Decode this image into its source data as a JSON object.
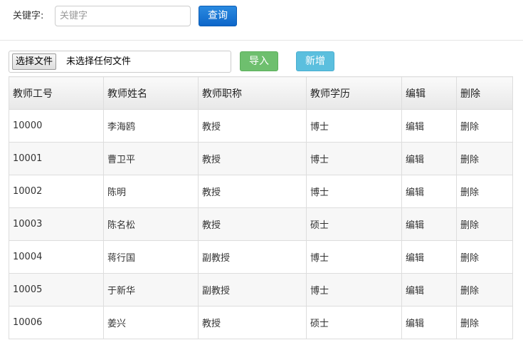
{
  "search": {
    "label": "关键字:",
    "placeholder": "关键字",
    "value": "",
    "query_button": "查询"
  },
  "upload": {
    "choose_button": "选择文件",
    "no_file_text": "未选择任何文件",
    "import_button": "导入",
    "add_button": "新增"
  },
  "colors": {
    "query_button": "#1574d6",
    "import_button": "#6ebf6e",
    "add_button": "#5bbfde",
    "id_text": "#1d3d8f"
  },
  "table": {
    "headers": [
      "教师工号",
      "教师姓名",
      "教师职称",
      "教师学历",
      "编辑",
      "删除"
    ],
    "rows": [
      {
        "id": "10000",
        "name": "李海鸥",
        "title": "教授",
        "degree": "博士",
        "edit": "编辑",
        "delete": "删除"
      },
      {
        "id": "10001",
        "name": "曹卫平",
        "title": "教授",
        "degree": "博士",
        "edit": "编辑",
        "delete": "删除"
      },
      {
        "id": "10002",
        "name": "陈明",
        "title": "教授",
        "degree": "博士",
        "edit": "编辑",
        "delete": "删除"
      },
      {
        "id": "10003",
        "name": "陈名松",
        "title": "教授",
        "degree": "硕士",
        "edit": "编辑",
        "delete": "删除"
      },
      {
        "id": "10004",
        "name": "蒋行国",
        "title": "副教授",
        "degree": "博士",
        "edit": "编辑",
        "delete": "删除"
      },
      {
        "id": "10005",
        "name": "于新华",
        "title": "副教授",
        "degree": "博士",
        "edit": "编辑",
        "delete": "删除"
      },
      {
        "id": "10006",
        "name": "姜兴",
        "title": "教授",
        "degree": "硕士",
        "edit": "编辑",
        "delete": "删除"
      }
    ]
  }
}
